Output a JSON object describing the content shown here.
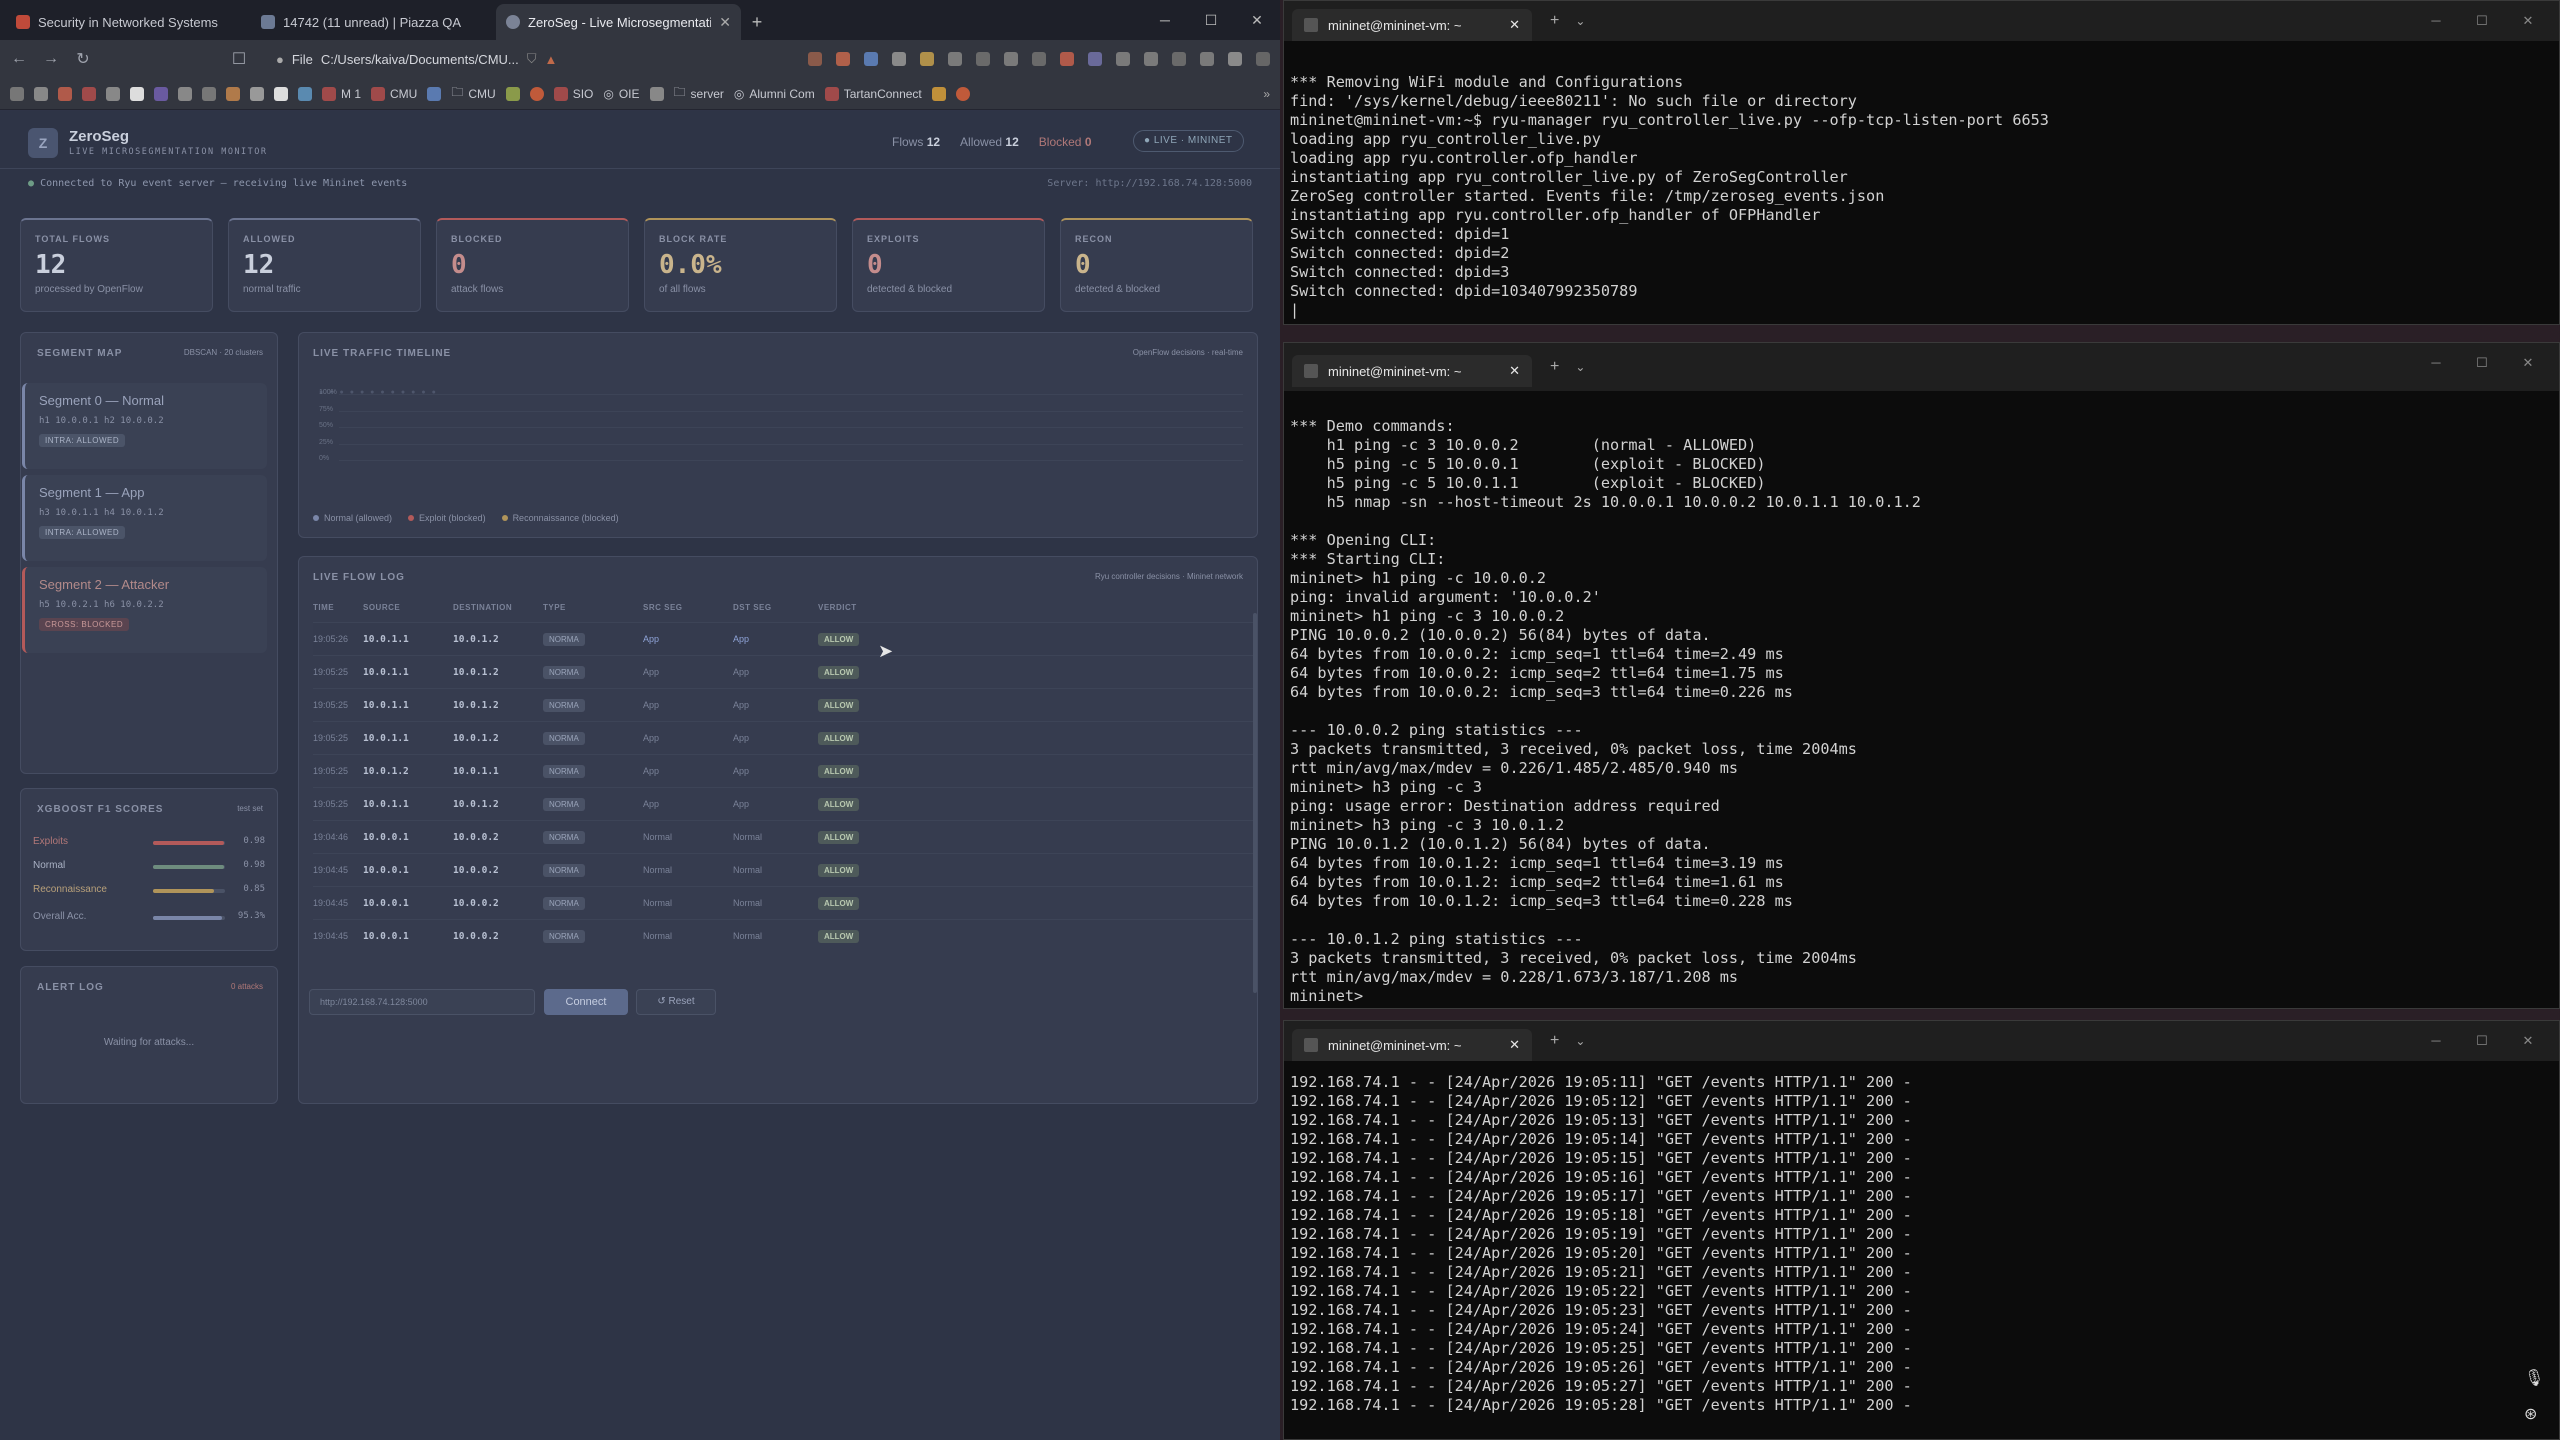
{
  "browser": {
    "tabs": [
      {
        "title": "Security in Networked Systems",
        "favicon": "red-shield-icon"
      },
      {
        "title": "14742 (11 unread) | Piazza QA",
        "favicon": "piazza-icon"
      },
      {
        "title": "ZeroSeg - Live Microsegmentation",
        "favicon": "globe-icon"
      }
    ],
    "url_scheme": "File",
    "url": "C:/Users/kaiva/Documents/CMU...",
    "bookmarks": [
      "M 1",
      "CMU",
      "CMU",
      "SIO",
      "OIE",
      "server",
      "Alumni Com",
      "TartanConnect"
    ]
  },
  "app": {
    "name": "ZeroSeg",
    "subtitle": "LIVE MICROSEGMENTATION MONITOR",
    "counters": {
      "flows_label": "Flows",
      "flows": "12",
      "allowed_label": "Allowed",
      "allowed": "12",
      "blocked_label": "Blocked",
      "blocked": "0"
    },
    "live_badge": "● LIVE · MININET",
    "conn_status": "Connected to Ryu event server — receiving live Mininet events",
    "server": "Server: http://192.168.74.128:5000",
    "stats": [
      {
        "label": "TOTAL FLOWS",
        "value": "12",
        "sub": "processed by OpenFlow",
        "color": "#c9cfdc",
        "accent": "#6b7490"
      },
      {
        "label": "ALLOWED",
        "value": "12",
        "sub": "normal traffic",
        "color": "#c9cfdc",
        "accent": "#6b7490"
      },
      {
        "label": "BLOCKED",
        "value": "0",
        "sub": "attack flows",
        "color": "#c48c8c",
        "accent": "#b35a5a"
      },
      {
        "label": "BLOCK RATE",
        "value": "0.0%",
        "sub": "of all flows",
        "color": "#c9b48c",
        "accent": "#b0945a"
      },
      {
        "label": "EXPLOITS",
        "value": "0",
        "sub": "detected & blocked",
        "color": "#c48c8c",
        "accent": "#b35a5a"
      },
      {
        "label": "RECON",
        "value": "0",
        "sub": "detected & blocked",
        "color": "#c9b48c",
        "accent": "#b0945a"
      }
    ],
    "segment_map": {
      "title": "SEGMENT MAP",
      "meta": "DBSCAN · 20 clusters",
      "segments": [
        {
          "title": "Segment 0 — Normal",
          "hosts": "h1 10.0.0.1 h2 10.0.0.2",
          "badge": "INTRA: ALLOWED",
          "accent": "#7a86a8",
          "badge_bg": "#4b5468",
          "badge_fg": "#aab3c6",
          "title_color": "#9aa3bb"
        },
        {
          "title": "Segment 1 — App",
          "hosts": "h3 10.0.1.1 h4 10.0.1.2",
          "badge": "INTRA: ALLOWED",
          "accent": "#7a86a8",
          "badge_bg": "#4b5468",
          "badge_fg": "#aab3c6",
          "title_color": "#9aa3bb"
        },
        {
          "title": "Segment 2 — Attacker",
          "hosts": "h5 10.0.2.1 h6 10.0.2.2",
          "badge": "CROSS: BLOCKED",
          "accent": "#b35a5a",
          "badge_bg": "#5a4450",
          "badge_fg": "#c89898",
          "title_color": "#b38a8a"
        }
      ]
    },
    "xgb": {
      "title": "XGBOOST F1 SCORES",
      "meta": "test set",
      "rows": [
        {
          "name": "Exploits",
          "score": 0.98,
          "label": "0.98",
          "color": "#b35a5a",
          "name_color": "#b37878"
        },
        {
          "name": "Normal",
          "score": 0.98,
          "label": "0.98",
          "color": "#6e8c7e",
          "name_color": "#a9b1c4"
        },
        {
          "name": "Reconnaissance",
          "score": 0.85,
          "label": "0.85",
          "color": "#b0945a",
          "name_color": "#b8a07a"
        },
        {
          "name": "Overall Acc.",
          "score": 0.953,
          "label": "95.3%",
          "color": "#7a86a8",
          "name_color": "#8a91a6"
        }
      ]
    },
    "alert_log": {
      "title": "ALERT LOG",
      "meta": "0 attacks",
      "empty": "Waiting for attacks..."
    },
    "timeline": {
      "title": "LIVE TRAFFIC TIMELINE",
      "meta": "OpenFlow decisions · real-time",
      "yticks": [
        "100%",
        "75%",
        "50%",
        "25%",
        "0%"
      ],
      "legend": [
        {
          "label": "Normal (allowed)",
          "color": "#7a86a8"
        },
        {
          "label": "Exploit (blocked)",
          "color": "#b35a5a"
        },
        {
          "label": "Reconnaissance (blocked)",
          "color": "#b0945a"
        }
      ]
    },
    "flowlog": {
      "title": "LIVE FLOW LOG",
      "meta": "Ryu controller decisions · Mininet network",
      "headers": [
        "TIME",
        "SOURCE",
        "DESTINATION",
        "TYPE",
        "SRC SEG",
        "DST SEG",
        "VERDICT"
      ],
      "rows": [
        [
          "19:05:26",
          "10.0.1.1",
          "10.0.1.2",
          "NORMA",
          "App",
          "App",
          "ALLOW"
        ],
        [
          "19:05:25",
          "10.0.1.1",
          "10.0.1.2",
          "NORMA",
          "App",
          "App",
          "ALLOW"
        ],
        [
          "19:05:25",
          "10.0.1.1",
          "10.0.1.2",
          "NORMA",
          "App",
          "App",
          "ALLOW"
        ],
        [
          "19:05:25",
          "10.0.1.1",
          "10.0.1.2",
          "NORMA",
          "App",
          "App",
          "ALLOW"
        ],
        [
          "19:05:25",
          "10.0.1.2",
          "10.0.1.1",
          "NORMA",
          "App",
          "App",
          "ALLOW"
        ],
        [
          "19:05:25",
          "10.0.1.1",
          "10.0.1.2",
          "NORMA",
          "App",
          "App",
          "ALLOW"
        ],
        [
          "19:04:46",
          "10.0.0.1",
          "10.0.0.2",
          "NORMA",
          "Normal",
          "Normal",
          "ALLOW"
        ],
        [
          "19:04:45",
          "10.0.0.1",
          "10.0.0.2",
          "NORMA",
          "Normal",
          "Normal",
          "ALLOW"
        ],
        [
          "19:04:45",
          "10.0.0.1",
          "10.0.0.2",
          "NORMA",
          "Normal",
          "Normal",
          "ALLOW"
        ],
        [
          "19:04:45",
          "10.0.0.1",
          "10.0.0.2",
          "NORMA",
          "Normal",
          "Normal",
          "ALLOW"
        ]
      ]
    },
    "server_input": "http://192.168.74.128:5000",
    "connect_label": "Connect",
    "reset_label": "↺ Reset"
  },
  "terminals": [
    {
      "tab": "mininet@mininet-vm: ~",
      "lines": [
        "*** Removing WiFi module and Configurations",
        "find: '/sys/kernel/debug/ieee80211': No such file or directory",
        "mininet@mininet-vm:~$ ryu-manager ryu_controller_live.py --ofp-tcp-listen-port 6653",
        "loading app ryu_controller_live.py",
        "loading app ryu.controller.ofp_handler",
        "instantiating app ryu_controller_live.py of ZeroSegController",
        "ZeroSeg controller started. Events file: /tmp/zeroseg_events.json",
        "instantiating app ryu.controller.ofp_handler of OFPHandler",
        "Switch connected: dpid=1",
        "Switch connected: dpid=2",
        "Switch connected: dpid=3",
        "Switch connected: dpid=103407992350789",
        "|"
      ]
    },
    {
      "tab": "mininet@mininet-vm: ~",
      "lines": [
        "*** Demo commands:",
        "    h1 ping -c 3 10.0.0.2        (normal - ALLOWED)",
        "    h5 ping -c 5 10.0.0.1        (exploit - BLOCKED)",
        "    h5 ping -c 5 10.0.1.1        (exploit - BLOCKED)",
        "    h5 nmap -sn --host-timeout 2s 10.0.0.1 10.0.0.2 10.0.1.1 10.0.1.2",
        "",
        "*** Opening CLI:",
        "*** Starting CLI:",
        "mininet> h1 ping -c 10.0.0.2",
        "ping: invalid argument: '10.0.0.2'",
        "mininet> h1 ping -c 3 10.0.0.2",
        "PING 10.0.0.2 (10.0.0.2) 56(84) bytes of data.",
        "64 bytes from 10.0.0.2: icmp_seq=1 ttl=64 time=2.49 ms",
        "64 bytes from 10.0.0.2: icmp_seq=2 ttl=64 time=1.75 ms",
        "64 bytes from 10.0.0.2: icmp_seq=3 ttl=64 time=0.226 ms",
        "",
        "--- 10.0.0.2 ping statistics ---",
        "3 packets transmitted, 3 received, 0% packet loss, time 2004ms",
        "rtt min/avg/max/mdev = 0.226/1.485/2.485/0.940 ms",
        "mininet> h3 ping -c 3",
        "ping: usage error: Destination address required",
        "mininet> h3 ping -c 3 10.0.1.2",
        "PING 10.0.1.2 (10.0.1.2) 56(84) bytes of data.",
        "64 bytes from 10.0.1.2: icmp_seq=1 ttl=64 time=3.19 ms",
        "64 bytes from 10.0.1.2: icmp_seq=2 ttl=64 time=1.61 ms",
        "64 bytes from 10.0.1.2: icmp_seq=3 ttl=64 time=0.228 ms",
        "",
        "--- 10.0.1.2 ping statistics ---",
        "3 packets transmitted, 3 received, 0% packet loss, time 2004ms",
        "rtt min/avg/max/mdev = 0.228/1.673/3.187/1.208 ms",
        "mininet> "
      ]
    },
    {
      "tab": "mininet@mininet-vm: ~",
      "lines": [
        "192.168.74.1 - - [24/Apr/2026 19:05:11] \"GET /events HTTP/1.1\" 200 -",
        "192.168.74.1 - - [24/Apr/2026 19:05:12] \"GET /events HTTP/1.1\" 200 -",
        "192.168.74.1 - - [24/Apr/2026 19:05:13] \"GET /events HTTP/1.1\" 200 -",
        "192.168.74.1 - - [24/Apr/2026 19:05:14] \"GET /events HTTP/1.1\" 200 -",
        "192.168.74.1 - - [24/Apr/2026 19:05:15] \"GET /events HTTP/1.1\" 200 -",
        "192.168.74.1 - - [24/Apr/2026 19:05:16] \"GET /events HTTP/1.1\" 200 -",
        "192.168.74.1 - - [24/Apr/2026 19:05:17] \"GET /events HTTP/1.1\" 200 -",
        "192.168.74.1 - - [24/Apr/2026 19:05:18] \"GET /events HTTP/1.1\" 200 -",
        "192.168.74.1 - - [24/Apr/2026 19:05:19] \"GET /events HTTP/1.1\" 200 -",
        "192.168.74.1 - - [24/Apr/2026 19:05:20] \"GET /events HTTP/1.1\" 200 -",
        "192.168.74.1 - - [24/Apr/2026 19:05:21] \"GET /events HTTP/1.1\" 200 -",
        "192.168.74.1 - - [24/Apr/2026 19:05:22] \"GET /events HTTP/1.1\" 200 -",
        "192.168.74.1 - - [24/Apr/2026 19:05:23] \"GET /events HTTP/1.1\" 200 -",
        "192.168.74.1 - - [24/Apr/2026 19:05:24] \"GET /events HTTP/1.1\" 200 -",
        "192.168.74.1 - - [24/Apr/2026 19:05:25] \"GET /events HTTP/1.1\" 200 -",
        "192.168.74.1 - - [24/Apr/2026 19:05:26] \"GET /events HTTP/1.1\" 200 -",
        "192.168.74.1 - - [24/Apr/2026 19:05:27] \"GET /events HTTP/1.1\" 200 -",
        "192.168.74.1 - - [24/Apr/2026 19:05:28] \"GET /events HTTP/1.1\" 200 -"
      ]
    }
  ]
}
